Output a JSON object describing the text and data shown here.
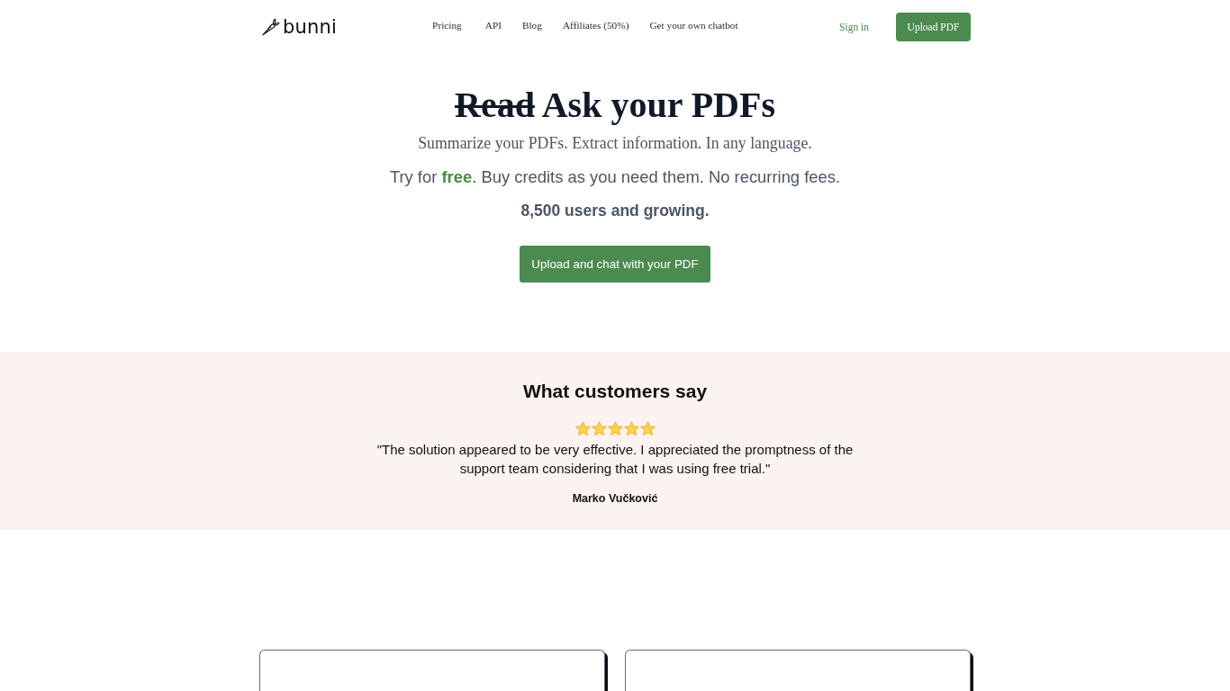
{
  "header": {
    "logo": "bunni",
    "nav": [
      "Pricing",
      "API",
      "Blog",
      "Affiliates (50%)",
      "Get your own chatbot"
    ],
    "sign_in": "Sign in",
    "upload_button": "Upload PDF"
  },
  "hero": {
    "headline": {
      "struck_word": "Read",
      "text": "Ask your PDFs"
    },
    "subtitle": "Summarize your PDFs. Extract information. In any language.",
    "pricing_line": "Try for **free**. Buy credits as you need them. No recurring fees.",
    "users_line": "8,500 users and growing.",
    "cta_button": "Upload and chat with your PDF"
  },
  "testimonials": {
    "title": "What customers say",
    "stars": 5,
    "quote": "\"The solution appeared to be very effective. I appreciated the promptness of the support team considering that I was using free trial.\"",
    "author": "Marko Vučković"
  },
  "cards": [
    {
      "kind": "empty"
    },
    {
      "kind": "empty"
    }
  ]
}
